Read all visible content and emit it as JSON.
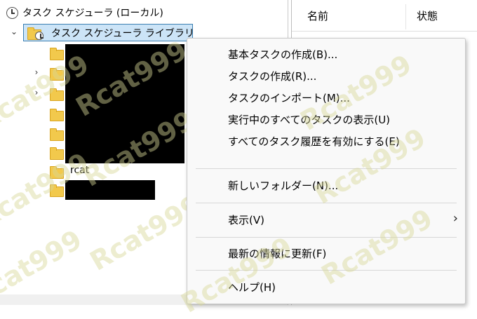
{
  "tree": {
    "root_label": "タスク スケジューラ (ローカル)",
    "library_label": "タスク スケジューラ ライブラリ",
    "visible_folder_label": "rcat"
  },
  "list": {
    "columns": [
      "名前",
      "状態"
    ]
  },
  "context_menu": {
    "items": [
      "基本タスクの作成(B)...",
      "タスクの作成(R)...",
      "タスクのインポート(M)...",
      "実行中のすべてのタスクの表示(U)",
      "すべてのタスク履歴を有効にする(E)",
      "新しいフォルダー(N)...",
      "表示(V)",
      "最新の情報に更新(F)",
      "ヘルプ(H)"
    ],
    "submenu_arrow": "›"
  },
  "watermark": "Rcat999",
  "icons": {
    "expand": "›",
    "collapse": "⌄"
  }
}
